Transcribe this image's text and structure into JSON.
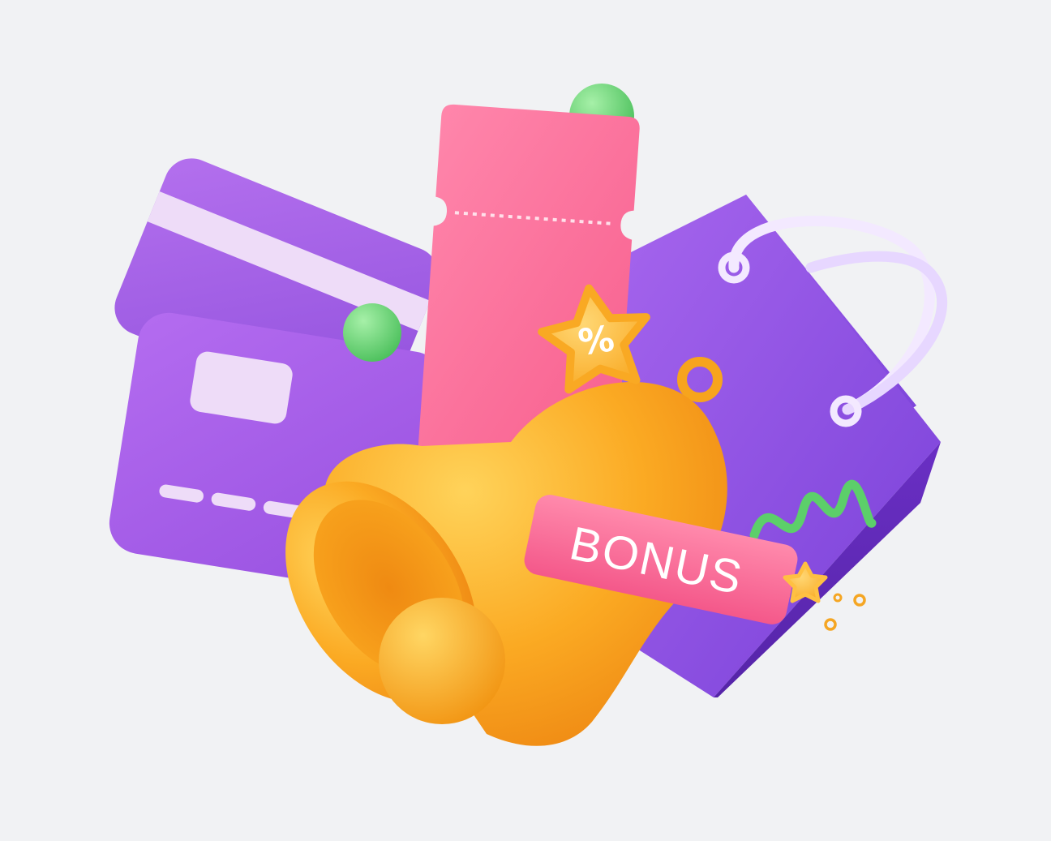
{
  "illustration": {
    "bonus_tag_text": "BONUS",
    "discount_badge_text": "%"
  },
  "palette": {
    "background": "#f1f2f4",
    "card_purple": "#a45fe6",
    "card_purple_dark": "#8b49d8",
    "card_stripe": "#eedcf8",
    "bag_purple": "#8d4fe3",
    "bag_purple_dark": "#6b32c8",
    "bag_handle": "#eee1ff",
    "ticket_pink": "#ff6f9a",
    "bell_orange": "#fdb022",
    "bell_orange_dark": "#f08c12",
    "star_yellow": "#ffc042",
    "ball_green": "#72d97a",
    "tag_pink": "#fb6a93",
    "tag_text": "#ffffff"
  },
  "icons": [
    "credit-card-icon",
    "shopping-bag-icon",
    "ticket-icon",
    "bell-icon",
    "percent-star-icon",
    "bonus-tag-icon",
    "star-icon",
    "spring-icon",
    "confetti-dot-icon"
  ]
}
